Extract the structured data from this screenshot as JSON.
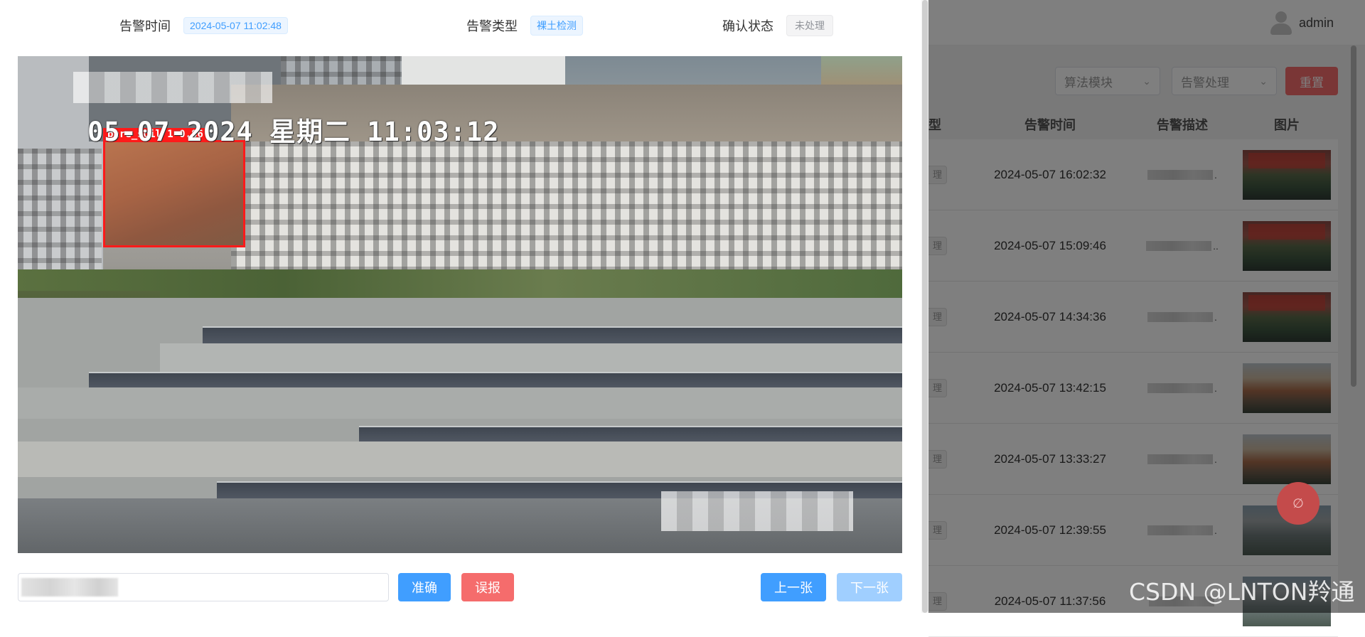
{
  "app": {
    "user_name": "admin",
    "filters": {
      "algorithm_placeholder": "算法模块",
      "handling_placeholder": "告警处理"
    },
    "reset_label": "重置",
    "table": {
      "headers": {
        "type": "型",
        "time": "告警时间",
        "description": "告警描述",
        "image": "图片"
      },
      "type_tag": "理",
      "rows": [
        {
          "time": "2024-05-07 16:02:32",
          "desc_tail": ".",
          "thumb": "red"
        },
        {
          "time": "2024-05-07 15:09:46",
          "desc_tail": "..",
          "thumb": "red"
        },
        {
          "time": "2024-05-07 14:34:36",
          "desc_tail": ".",
          "thumb": "red"
        },
        {
          "time": "2024-05-07 13:42:15",
          "desc_tail": ".",
          "thumb": "brown"
        },
        {
          "time": "2024-05-07 13:33:27",
          "desc_tail": ".",
          "thumb": "brown"
        },
        {
          "time": "2024-05-07 12:39:55",
          "desc_tail": ".",
          "thumb": "city"
        },
        {
          "time": "2024-05-07 11:37:56",
          "desc_tail": "",
          "thumb": "city"
        }
      ]
    },
    "watermark": "CSDN @LNTON羚通"
  },
  "dialog": {
    "alarm_time_label": "告警时间",
    "alarm_time_value": "2024-05-07 11:02:48",
    "alarm_type_label": "告警类型",
    "alarm_type_value": "裸土检测",
    "confirm_status_label": "确认状态",
    "confirm_status_value": "未处理",
    "camera_overlay_text": "05-07-2024 星期二 11:03:12",
    "detection_label": "bare_soil  1  0.86",
    "remark_placeholder": "",
    "accurate_label": "准确",
    "false_alarm_label": "误报",
    "prev_label": "上一张",
    "next_label": "下一张"
  },
  "colors": {
    "primary": "#409eff",
    "danger": "#f56c6c",
    "primary_disabled": "#a0cfff",
    "detection_box": "#ff1a1a"
  },
  "icons": {
    "avatar": "user-avatar-icon",
    "dropdown": "chevron-down-icon",
    "float": "bell-off-icon"
  }
}
